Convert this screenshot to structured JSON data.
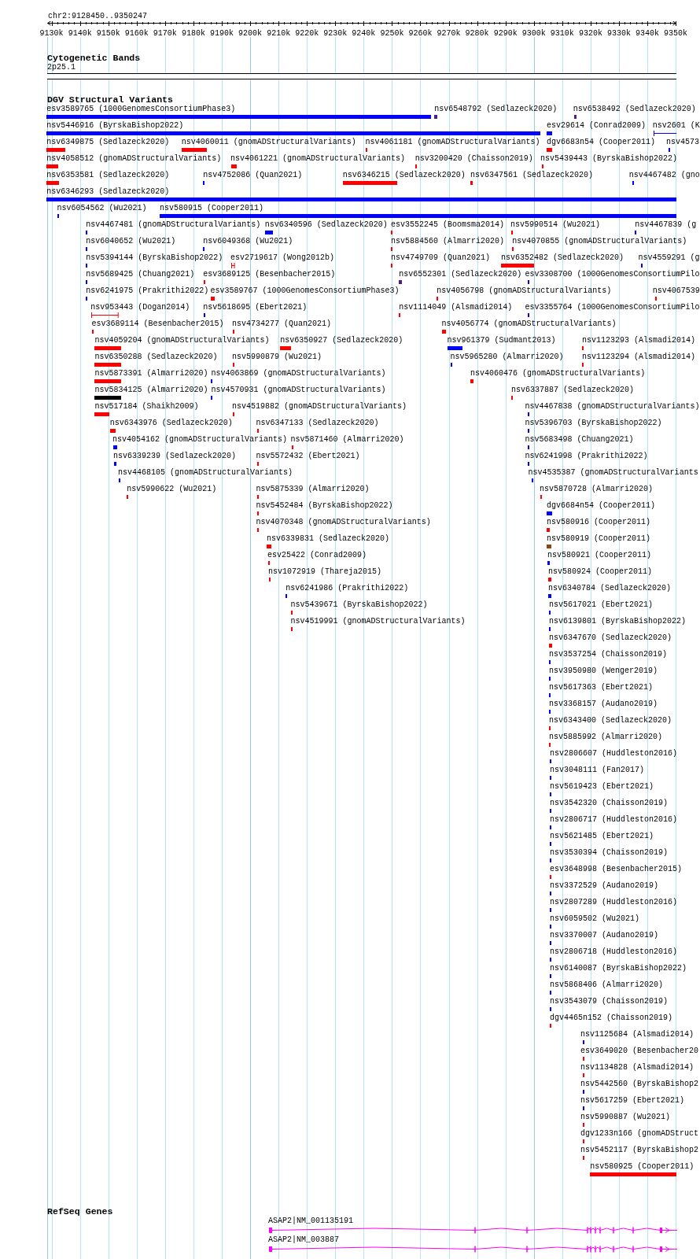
{
  "locus": "chr2:9128450..9350247",
  "ruler": {
    "ticks": [
      "9130k",
      "9140k",
      "9150k",
      "9160k",
      "9170k",
      "9180k",
      "9190k",
      "9200k",
      "9210k",
      "9220k",
      "9230k",
      "9240k",
      "9250k",
      "9260k",
      "9270k",
      "9280k",
      "9290k",
      "9300k",
      "9310k",
      "9320k",
      "9330k",
      "9340k",
      "9350k"
    ]
  },
  "tracks": [
    {
      "kind": "bands",
      "title": "Cytogenetic Bands",
      "bands": [
        {
          "name": "2p25.1"
        }
      ]
    },
    {
      "kind": "variants",
      "title": "DGV Structural Variants",
      "rows": [
        [
          {
            "label": "esv3589765 (1000GenomesConsortiumPhase3)",
            "kind": "block",
            "color": "#0000ff"
          },
          {
            "label": "nsv6548792 (Sedlazeck2020)",
            "kind": "block",
            "color": "#551a8b"
          },
          {
            "label": "nsv6538492 (Sedlazeck2020)",
            "kind": "block",
            "color": "#551a8b"
          }
        ],
        [
          {
            "label": "nsv5446916 (ByrskaBishop2022)",
            "kind": "block",
            "color": "#0000ff"
          },
          {
            "label": "esv29614 (Conrad2009)",
            "kind": "block",
            "color": "#0000ff"
          },
          {
            "label": "nsv2601 (K",
            "kind": "span",
            "color": "#0000ff"
          }
        ],
        [
          {
            "label": "nsv6349875 (Sedlazeck2020)",
            "kind": "block",
            "color": "#ff0000"
          },
          {
            "label": "nsv4060011 (gnomADStructuralVariants)",
            "kind": "block",
            "color": "#ff0000"
          },
          {
            "label": "nsv4061181 (gnomADStructuralVariants)",
            "kind": "block",
            "color": "#ff0000"
          },
          {
            "label": "dgv6683n54 (Cooper2011)",
            "kind": "block",
            "color": "#ff0000"
          },
          {
            "label": "nsv4573",
            "kind": "block",
            "color": "#0000ff"
          }
        ],
        [
          {
            "label": "nsv4058512 (gnomADStructuralVariants)",
            "kind": "block",
            "color": "#ff0000"
          },
          {
            "label": "nsv4061221 (gnomADStructuralVariants)",
            "kind": "block",
            "color": "#ff0000"
          },
          {
            "label": "nsv3200420 (Chaisson2019)",
            "kind": "block",
            "color": "#ff0000"
          },
          {
            "label": "nsv5439443 (ByrskaBishop2022)",
            "kind": "block",
            "color": "#ff0000"
          }
        ],
        [
          {
            "label": "nsv6353581 (Sedlazeck2020)",
            "kind": "block",
            "color": "#ff0000"
          },
          {
            "label": "nsv4752086 (Quan2021)",
            "kind": "block",
            "color": "#0000ff"
          },
          {
            "label": "nsv6346215 (Sedlazeck2020)",
            "kind": "block",
            "color": "#ff0000"
          },
          {
            "label": "nsv6347561 (Sedlazeck2020)",
            "kind": "block",
            "color": "#ff0000"
          },
          {
            "label": "nsv4467482 (gno",
            "kind": "block",
            "color": "#0000ff"
          }
        ],
        [
          {
            "label": "nsv6346293 (Sedlazeck2020)",
            "kind": "block",
            "color": "#0000ff"
          }
        ],
        [
          {
            "label": "nsv6054562 (Wu2021)",
            "kind": "block",
            "color": "#0000ff"
          },
          {
            "label": "nsv580915 (Cooper2011)",
            "kind": "block",
            "color": "#0000ff"
          }
        ],
        [
          {
            "label": "nsv4467481 (gnomADStructuralVariants)",
            "kind": "block",
            "color": "#0000ff"
          },
          {
            "label": "nsv6340596 (Sedlazeck2020)",
            "kind": "block",
            "color": "#0000ff"
          },
          {
            "label": "esv3552245 (Boomsma2014)",
            "kind": "block",
            "color": "#ff0000"
          },
          {
            "label": "nsv5990514 (Wu2021)",
            "kind": "block",
            "color": "#ff0000"
          },
          {
            "label": "nsv4467839 (g",
            "kind": "block",
            "color": "#0000ff"
          }
        ],
        [
          {
            "label": "nsv6040652 (Wu2021)",
            "kind": "block",
            "color": "#0000ff"
          },
          {
            "label": "nsv6049368 (Wu2021)",
            "kind": "block",
            "color": "#0000ff"
          },
          {
            "label": "nsv5884560 (Almarri2020)",
            "kind": "block",
            "color": "#ff0000"
          },
          {
            "label": "nsv4070855 (gnomADStructuralVariants)",
            "kind": "block",
            "color": "#ff0000"
          }
        ],
        [
          {
            "label": "nsv5394144 (ByrskaBishop2022)",
            "kind": "block",
            "color": "#0000ff"
          },
          {
            "label": "esv2719617 (Wong2012b)",
            "kind": "span",
            "color": "#ff0000"
          },
          {
            "label": "nsv4749709 (Quan2021)",
            "kind": "block",
            "color": "#ff0000"
          },
          {
            "label": "nsv6352482 (Sedlazeck2020)",
            "kind": "block",
            "color": "#ff0000"
          },
          {
            "label": "nsv4559291 (g",
            "kind": "block",
            "color": "#0000ff"
          }
        ],
        [
          {
            "label": "nsv5689425 (Chuang2021)",
            "kind": "block",
            "color": "#0000ff"
          },
          {
            "label": "esv3689125 (Besenbacher2015)",
            "kind": "block",
            "color": "#ff0000"
          },
          {
            "label": "nsv6552301 (Sedlazeck2020)",
            "kind": "block",
            "color": "#551a8b"
          },
          {
            "label": "esv3308700 (1000GenomesConsortiumPilo",
            "kind": "block",
            "color": "#0000ff"
          }
        ],
        [
          {
            "label": "nsv6241975 (Prakrithi2022)",
            "kind": "block",
            "color": "#0000ff"
          },
          {
            "label": "esv3589767 (1000GenomesConsortiumPhase3)",
            "kind": "block",
            "color": "#ff0000"
          },
          {
            "label": "nsv4056798 (gnomADStructuralVariants)",
            "kind": "block",
            "color": "#ff0000"
          },
          {
            "label": "nsv4067539",
            "kind": "block",
            "color": "#ff0000"
          }
        ],
        [
          {
            "label": "nsv953443 (Dogan2014)",
            "kind": "span",
            "color": "#ff0000"
          },
          {
            "label": "nsv5618695 (Ebert2021)",
            "kind": "block",
            "color": "#0000ff"
          },
          {
            "label": "nsv1114049 (Alsmadi2014)",
            "kind": "block",
            "color": "#ff0000"
          },
          {
            "label": "esv3355764 (1000GenomesConsortiumPilo",
            "kind": "block",
            "color": "#0000ff"
          }
        ],
        [
          {
            "label": "esv3689114 (Besenbacher2015)",
            "kind": "block",
            "color": "#ff0000"
          },
          {
            "label": "nsv4734277 (Quan2021)",
            "kind": "block",
            "color": "#ff0000"
          },
          {
            "label": "nsv4056774 (gnomADStructuralVariants)",
            "kind": "block",
            "color": "#ff0000"
          }
        ],
        [
          {
            "label": "nsv4059204 (gnomADStructuralVariants)",
            "kind": "block",
            "color": "#ff0000"
          },
          {
            "label": "nsv6350927 (Sedlazeck2020)",
            "kind": "block",
            "color": "#ff0000"
          },
          {
            "label": "nsv961379 (Sudmant2013)",
            "kind": "block",
            "color": "#0000ff"
          },
          {
            "label": "nsv1123293 (Alsmadi2014)",
            "kind": "block",
            "color": "#ff0000"
          }
        ],
        [
          {
            "label": "nsv6350288 (Sedlazeck2020)",
            "kind": "block",
            "color": "#ff0000"
          },
          {
            "label": "nsv5990879 (Wu2021)",
            "kind": "block",
            "color": "#ff0000"
          },
          {
            "label": "nsv5965280 (Almarri2020)",
            "kind": "block",
            "color": "#0000ff"
          },
          {
            "label": "nsv1123294 (Alsmadi2014)",
            "kind": "block",
            "color": "#ff0000"
          }
        ],
        [
          {
            "label": "nsv5873391 (Almarri2020)",
            "kind": "block",
            "color": "#ff0000"
          },
          {
            "label": "nsv4063869 (gnomADStructuralVariants)",
            "kind": "block",
            "color": "#0000ff"
          },
          {
            "label": "nsv4060476 (gnomADStructuralVariants)",
            "kind": "block",
            "color": "#ff0000"
          }
        ],
        [
          {
            "label": "nsv5834125 (Almarri2020)",
            "kind": "block",
            "color": "#000000"
          },
          {
            "label": "nsv4570931 (gnomADStructuralVariants)",
            "kind": "block",
            "color": "#0000ff"
          },
          {
            "label": "nsv6337887 (Sedlazeck2020)",
            "kind": "block",
            "color": "#ff0000"
          }
        ],
        [
          {
            "label": "nsv517184 (Shaikh2009)",
            "kind": "block",
            "color": "#ff0000"
          },
          {
            "label": "nsv4519882 (gnomADStructuralVariants)",
            "kind": "block",
            "color": "#ff0000"
          },
          {
            "label": "nsv4467838 (gnomADStructuralVariants)",
            "kind": "block",
            "color": "#0000ff"
          }
        ],
        [
          {
            "label": "nsv6343976 (Sedlazeck2020)",
            "kind": "block",
            "color": "#ff0000"
          },
          {
            "label": "nsv6347133 (Sedlazeck2020)",
            "kind": "block",
            "color": "#ff0000"
          },
          {
            "label": "nsv5396703 (ByrskaBishop2022)",
            "kind": "block",
            "color": "#0000ff"
          }
        ],
        [
          {
            "label": "nsv4054162 (gnomADStructuralVariants)",
            "kind": "block",
            "color": "#0000ff"
          },
          {
            "label": "nsv5871460 (Almarri2020)",
            "kind": "block",
            "color": "#ff0000"
          },
          {
            "label": "nsv5683498 (Chuang2021)",
            "kind": "block",
            "color": "#0000ff"
          }
        ],
        [
          {
            "label": "nsv6339239 (Sedlazeck2020)",
            "kind": "block",
            "color": "#0000ff"
          },
          {
            "label": "nsv5572432 (Ebert2021)",
            "kind": "block",
            "color": "#ff0000"
          },
          {
            "label": "nsv6241998 (Prakrithi2022)",
            "kind": "block",
            "color": "#0000ff"
          }
        ],
        [
          {
            "label": "nsv4468105 (gnomADStructuralVariants)",
            "kind": "block",
            "color": "#0000ff"
          },
          {
            "label": "nsv4535387 (gnomADStructuralVariants",
            "kind": "block",
            "color": "#0000ff"
          }
        ],
        [
          {
            "label": "nsv5990622 (Wu2021)",
            "kind": "block",
            "color": "#ff0000"
          },
          {
            "label": "nsv5875339 (Almarri2020)",
            "kind": "block",
            "color": "#ff0000"
          },
          {
            "label": "nsv5870728 (Almarri2020)",
            "kind": "block",
            "color": "#ff0000"
          }
        ],
        [
          {
            "label": "nsv5452484 (ByrskaBishop2022)",
            "kind": "block",
            "color": "#ff0000"
          },
          {
            "label": "dgv6684n54 (Cooper2011)",
            "kind": "block",
            "color": "#0000ff"
          }
        ],
        [
          {
            "label": "nsv4070348 (gnomADStructuralVariants)",
            "kind": "block",
            "color": "#ff0000"
          },
          {
            "label": "nsv580916 (Cooper2011)",
            "kind": "block",
            "color": "#ff0000"
          }
        ],
        [
          {
            "label": "nsv6339831 (Sedlazeck2020)",
            "kind": "block",
            "color": "#ff0000"
          },
          {
            "label": "nsv580919 (Cooper2011)",
            "kind": "block",
            "color": "#8b4513"
          }
        ],
        [
          {
            "label": "esv25422 (Conrad2009)",
            "kind": "block",
            "color": "#ff0000"
          },
          {
            "label": "nsv580921 (Cooper2011)",
            "kind": "block",
            "color": "#0000ff"
          }
        ],
        [
          {
            "label": "nsv1072919 (Thareja2015)",
            "kind": "block",
            "color": "#ff0000"
          },
          {
            "label": "nsv580924 (Cooper2011)",
            "kind": "block",
            "color": "#ff0000"
          }
        ],
        [
          {
            "label": "nsv6241986 (Prakrithi2022)",
            "kind": "block",
            "color": "#0000ff"
          },
          {
            "label": "nsv6340784 (Sedlazeck2020)",
            "kind": "block",
            "color": "#0000ff"
          }
        ],
        [
          {
            "label": "nsv5439671 (ByrskaBishop2022)",
            "kind": "block",
            "color": "#ff0000"
          },
          {
            "label": "nsv5617021 (Ebert2021)",
            "kind": "block",
            "color": "#0000ff"
          }
        ],
        [
          {
            "label": "nsv4519991 (gnomADStructuralVariants)",
            "kind": "block",
            "color": "#ff0000"
          },
          {
            "label": "nsv6139801 (ByrskaBishop2022)",
            "kind": "block",
            "color": "#0000ff"
          }
        ],
        [
          {
            "label": "nsv6347670 (Sedlazeck2020)",
            "kind": "block",
            "color": "#ff0000"
          }
        ],
        [
          {
            "label": "nsv3537254 (Chaisson2019)",
            "kind": "block",
            "color": "#0000ff"
          }
        ],
        [
          {
            "label": "nsv3950980 (Wenger2019)",
            "kind": "block",
            "color": "#0000ff"
          }
        ],
        [
          {
            "label": "nsv5617363 (Ebert2021)",
            "kind": "block",
            "color": "#0000ff"
          }
        ],
        [
          {
            "label": "nsv3368157 (Audano2019)",
            "kind": "block",
            "color": "#0000ff"
          }
        ],
        [
          {
            "label": "nsv6343400 (Sedlazeck2020)",
            "kind": "block",
            "color": "#ff0000"
          }
        ],
        [
          {
            "label": "nsv5885992 (Almarri2020)",
            "kind": "block",
            "color": "#ff0000"
          }
        ],
        [
          {
            "label": "nsv2806607 (Huddleston2016)",
            "kind": "block",
            "color": "#0000ff"
          }
        ],
        [
          {
            "label": "nsv3048111 (Fan2017)",
            "kind": "block",
            "color": "#0000ff"
          }
        ],
        [
          {
            "label": "nsv5619423 (Ebert2021)",
            "kind": "block",
            "color": "#0000ff"
          }
        ],
        [
          {
            "label": "nsv3542320 (Chaisson2019)",
            "kind": "block",
            "color": "#0000ff"
          }
        ],
        [
          {
            "label": "nsv2806717 (Huddleston2016)",
            "kind": "block",
            "color": "#0000ff"
          }
        ],
        [
          {
            "label": "nsv5621485 (Ebert2021)",
            "kind": "block",
            "color": "#0000ff"
          }
        ],
        [
          {
            "label": "nsv3530394 (Chaisson2019)",
            "kind": "block",
            "color": "#0000ff"
          }
        ],
        [
          {
            "label": "esv3648998 (Besenbacher2015)",
            "kind": "block",
            "color": "#ff0000"
          }
        ],
        [
          {
            "label": "nsv3372529 (Audano2019)",
            "kind": "block",
            "color": "#0000ff"
          }
        ],
        [
          {
            "label": "nsv2807289 (Huddleston2016)",
            "kind": "block",
            "color": "#0000ff"
          }
        ],
        [
          {
            "label": "nsv6059502 (Wu2021)",
            "kind": "block",
            "color": "#0000ff"
          }
        ],
        [
          {
            "label": "nsv3370007 (Audano2019)",
            "kind": "block",
            "color": "#0000ff"
          }
        ],
        [
          {
            "label": "nsv2806718 (Huddleston2016)",
            "kind": "block",
            "color": "#0000ff"
          }
        ],
        [
          {
            "label": "nsv6140087 (ByrskaBishop2022)",
            "kind": "block",
            "color": "#0000ff"
          }
        ],
        [
          {
            "label": "nsv5868406 (Almarri2020)",
            "kind": "block",
            "color": "#0000ff"
          }
        ],
        [
          {
            "label": "nsv3543079 (Chaisson2019)",
            "kind": "block",
            "color": "#0000ff"
          }
        ],
        [
          {
            "label": "dgv4465n152 (Chaisson2019)",
            "kind": "block",
            "color": "#ff0000"
          }
        ],
        [
          {
            "label": "nsv1125684 (Alsmadi2014)",
            "kind": "block",
            "color": "#0000ff"
          }
        ],
        [
          {
            "label": "esv3649020 (Besenbacher20",
            "kind": "block",
            "color": "#ff0000"
          }
        ],
        [
          {
            "label": "nsv1134828 (Alsmadi2014)",
            "kind": "block",
            "color": "#ff0000"
          }
        ],
        [
          {
            "label": "nsv5442560 (ByrskaBishop2",
            "kind": "block",
            "color": "#0000ff"
          }
        ],
        [
          {
            "label": "nsv5617259 (Ebert2021)",
            "kind": "block",
            "color": "#0000ff"
          }
        ],
        [
          {
            "label": "nsv5990887 (Wu2021)",
            "kind": "block",
            "color": "#ff0000"
          }
        ],
        [
          {
            "label": "dgv1233n166 (gnomADStruct",
            "kind": "block",
            "color": "#ff0000"
          }
        ],
        [
          {
            "label": "nsv5452117 (ByrskaBishop2",
            "kind": "block",
            "color": "#ff0000"
          }
        ],
        [
          {
            "label": "nsv580925 (Cooper2011)",
            "kind": "block",
            "color": "#ff0000"
          }
        ]
      ]
    },
    {
      "kind": "genes",
      "title": "RefSeq Genes",
      "transcripts": [
        {
          "label": "ASAP2|NM_001135191"
        },
        {
          "label": "ASAP2|NM_003887"
        }
      ]
    }
  ]
}
